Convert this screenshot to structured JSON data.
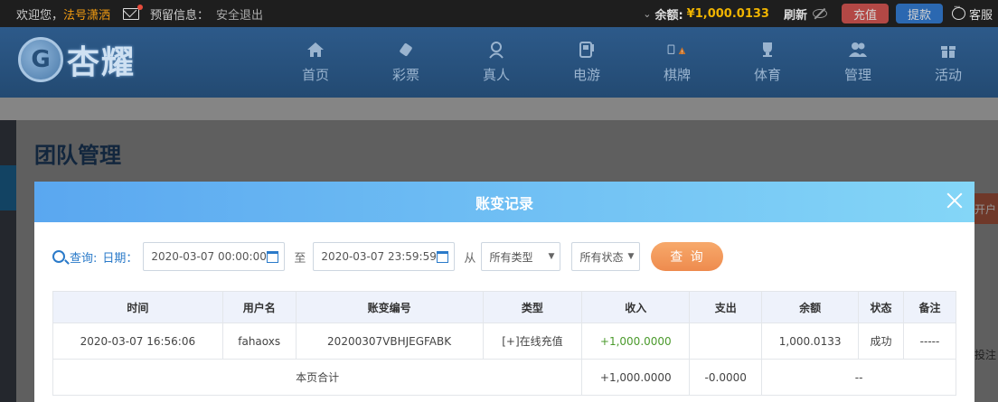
{
  "topbar": {
    "welcome": "欢迎您，",
    "username": "法号潇洒",
    "notice": "预留信息：",
    "logout": "安全退出",
    "balance_label": "余额:",
    "balance_value": "¥1,000.0133",
    "refresh": "刷新",
    "recharge": "充值",
    "withdraw": "提款",
    "service": "客服"
  },
  "brand": {
    "logo_text": "杏耀"
  },
  "nav": [
    {
      "label": "首页",
      "icon": "home-icon"
    },
    {
      "label": "彩票",
      "icon": "lottery-icon"
    },
    {
      "label": "真人",
      "icon": "live-dealer-icon"
    },
    {
      "label": "电游",
      "icon": "slot-game-icon"
    },
    {
      "label": "棋牌",
      "icon": "cards-icon"
    },
    {
      "label": "体育",
      "icon": "trophy-icon"
    },
    {
      "label": "管理",
      "icon": "users-icon"
    },
    {
      "label": "活动",
      "icon": "gift-icon"
    }
  ],
  "page": {
    "title": "团队管理",
    "right_button": "开户",
    "right_text": "投注"
  },
  "modal": {
    "title": "账变记录",
    "filters": {
      "query_label": "查询:",
      "date_label": "日期：",
      "start": "2020-03-07 00:00:00",
      "to_label": "至",
      "end": "2020-03-07 23:59:59",
      "from_label": "从",
      "type_select": "所有类型",
      "status_select": "所有状态",
      "query_button": "查 询"
    },
    "table": {
      "headers": [
        "时间",
        "用户名",
        "账变编号",
        "类型",
        "收入",
        "支出",
        "余额",
        "状态",
        "备注"
      ],
      "rows": [
        [
          "2020-03-07 16:56:06",
          "fahaoxs",
          "20200307VBHJEGFABK",
          "[+]在线充值",
          "+1,000.0000",
          "",
          "1,000.0133",
          "成功",
          "-----"
        ]
      ],
      "summary": {
        "label": "本页合计",
        "income": "+1,000.0000",
        "expense": "-0.0000",
        "rest": "--"
      }
    }
  },
  "colors": {
    "accent": "#2a7ac9",
    "header_gradient_start": "#5aa7f0",
    "header_gradient_end": "#84d6f7",
    "query_button": "#ee8b4e",
    "balance": "#f0b400"
  }
}
